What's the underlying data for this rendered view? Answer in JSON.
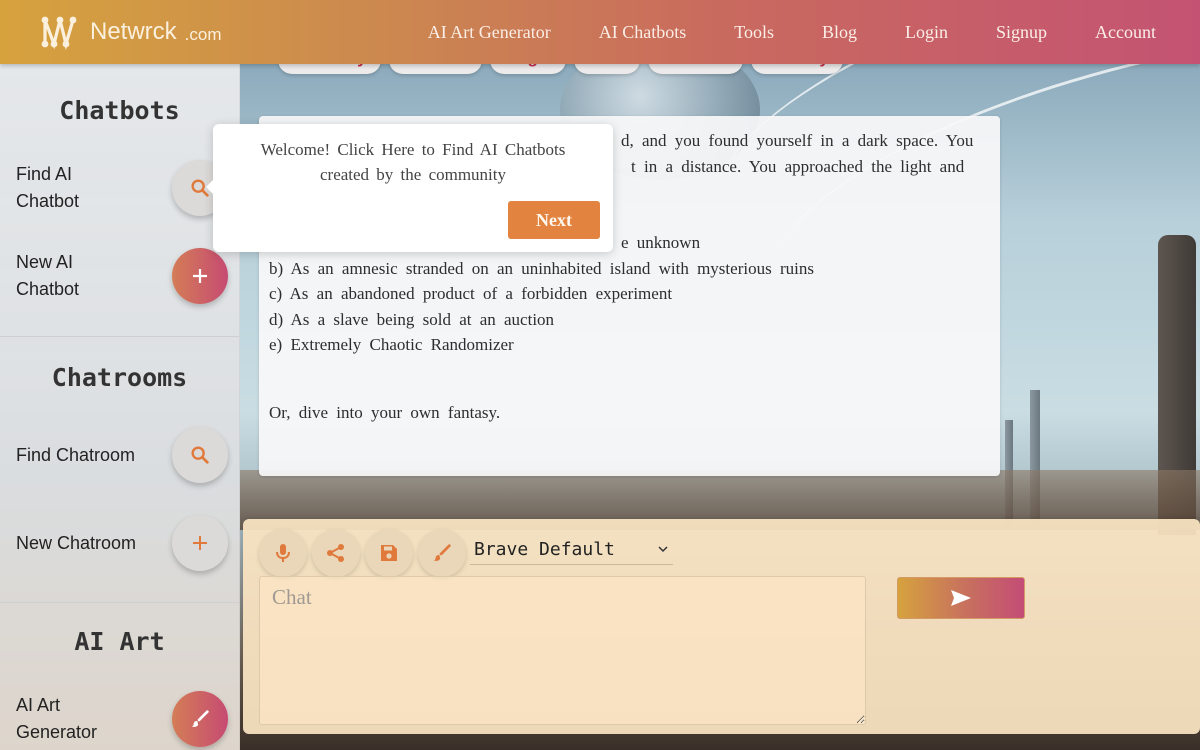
{
  "header": {
    "brand_name": "Netwrck",
    "brand_tld": ".com",
    "nav": [
      {
        "label": "AI Art Generator"
      },
      {
        "label": "AI Chatbots"
      },
      {
        "label": "Tools"
      },
      {
        "label": "Blog"
      },
      {
        "label": "Login"
      },
      {
        "label": "Signup"
      },
      {
        "label": "Account"
      }
    ]
  },
  "tags": [
    "Mitiraday",
    "Discuss",
    "Magic",
    "Rare",
    "Western",
    "Fantasy"
  ],
  "sidebar": {
    "sections": [
      {
        "title": "Chatbots",
        "items": [
          {
            "label_line1": "Find AI",
            "label_line2": "Chatbot",
            "icon": "search-icon"
          },
          {
            "label_line1": "New AI",
            "label_line2": "Chatbot",
            "icon": "plus-icon"
          }
        ]
      },
      {
        "title": "Chatrooms",
        "items": [
          {
            "label": "Find Chatroom",
            "icon": "search-icon"
          },
          {
            "label": "New Chatroom",
            "icon": "plus-icon"
          }
        ]
      },
      {
        "title": "AI Art",
        "items": [
          {
            "label_line1": "AI Art",
            "label_line2": "Generator",
            "icon": "brush-icon"
          }
        ]
      }
    ]
  },
  "story": {
    "line1_visible": "d, and you found yourself in a dark space. You",
    "line2_visible": "t in a distance. You approached the light and",
    "option_a_visible": "e unknown",
    "option_b": "b) As an amnesic stranded on an uninhabited island with mysterious ruins",
    "option_c": "c) As an abandoned product of a forbidden experiment",
    "option_d": "d) As a slave being sold at an auction",
    "option_e": "e) Extremely Chaotic Randomizer",
    "closing": "Or, dive into your own fantasy."
  },
  "popover": {
    "text": "Welcome! Click Here to Find AI Chatbots created by the community",
    "next_label": "Next"
  },
  "composer": {
    "tools": [
      "microphone-icon",
      "share-icon",
      "save-icon",
      "brush-icon"
    ],
    "voice_select_value": "Brave Default",
    "chat_placeholder": "Chat",
    "chat_value": "",
    "send_icon": "send-icon"
  },
  "colors": {
    "accent_orange": "#e2843f",
    "header_gradient_start": "#d6a23e",
    "header_gradient_end": "#c45373",
    "tag_text": "#c8334c",
    "icon_orange": "#e07a3c"
  }
}
